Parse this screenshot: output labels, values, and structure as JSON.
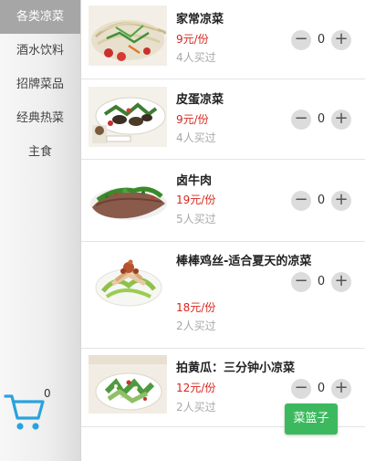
{
  "sidebar": {
    "categories": [
      {
        "label": "各类凉菜",
        "active": true
      },
      {
        "label": "酒水饮料",
        "active": false
      },
      {
        "label": "招牌菜品",
        "active": false
      },
      {
        "label": "经典热菜",
        "active": false
      },
      {
        "label": "主食",
        "active": false
      }
    ],
    "cart_count": "0",
    "cart_icon": "shopping-cart-icon"
  },
  "dishes": [
    {
      "name": "家常凉菜",
      "price": "9元/份",
      "sold": "4人买过",
      "qty": "0"
    },
    {
      "name": "皮蛋凉菜",
      "price": "9元/份",
      "sold": "4人买过",
      "qty": "0"
    },
    {
      "name": "卤牛肉",
      "price": "19元/份",
      "sold": "5人买过",
      "qty": "0"
    },
    {
      "name": "棒棒鸡丝-适合夏天的凉菜",
      "price": "18元/份",
      "sold": "2人买过",
      "qty": "0"
    },
    {
      "name": "拍黄瓜：三分钟小凉菜",
      "price": "12元/份",
      "sold": "2人买过",
      "qty": "0"
    }
  ],
  "stepper": {
    "minus": "−",
    "plus": "+"
  },
  "basket_button": "菜篮子",
  "colors": {
    "accent_green": "#3cb95e",
    "price_red": "#d9251c",
    "cart_blue": "#29a3dd",
    "active_category_bg": "#a6a6a6"
  }
}
